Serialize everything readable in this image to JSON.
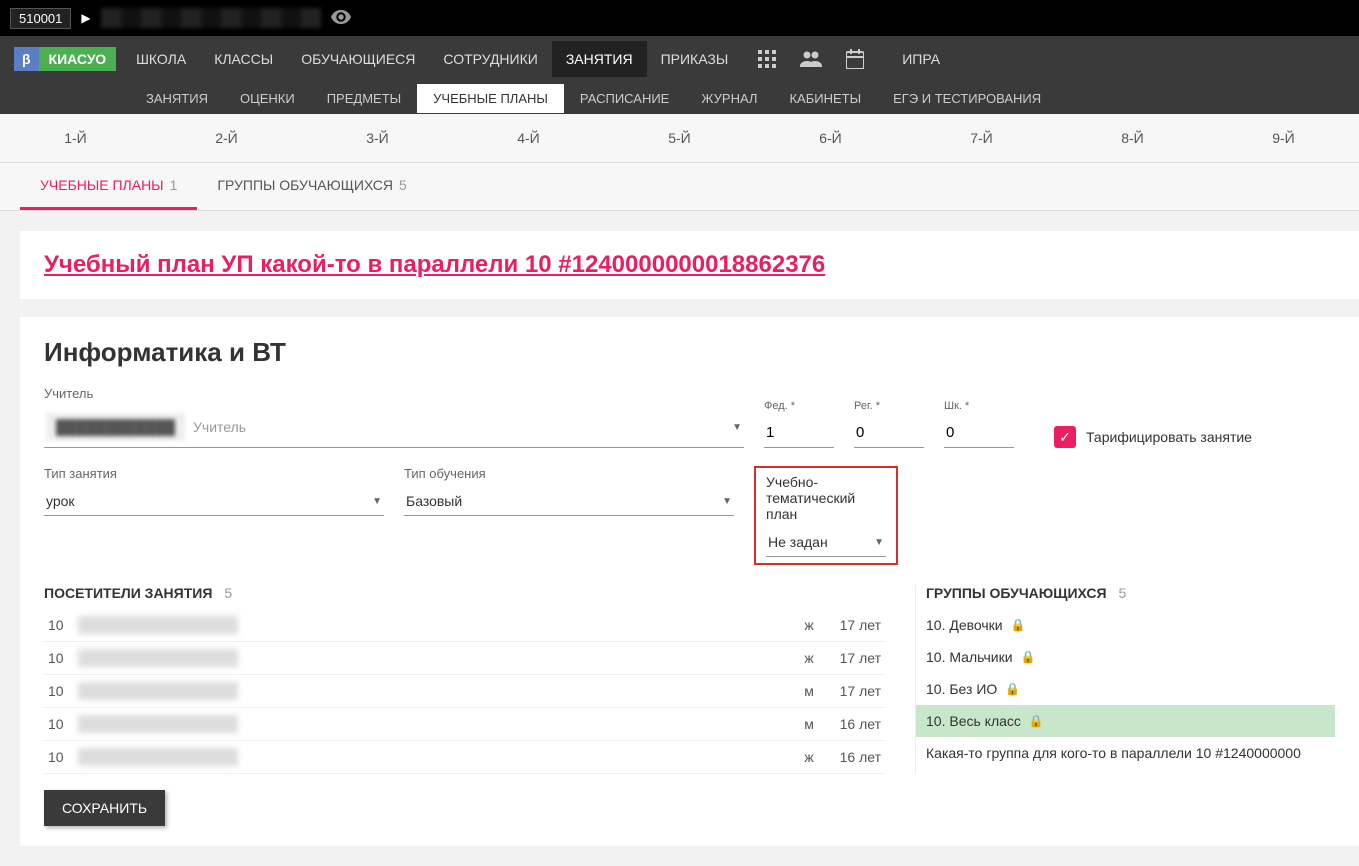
{
  "topbar": {
    "id": "510001"
  },
  "logo": {
    "beta": "β",
    "name": "КИАСУО"
  },
  "mainnav": [
    "ШКОЛА",
    "КЛАССЫ",
    "ОБУЧАЮЩИЕСЯ",
    "СОТРУДНИКИ",
    "ЗАНЯТИЯ",
    "ПРИКАЗЫ"
  ],
  "mainnav_active": 4,
  "mainnav_right": "ИПРА",
  "subnav": [
    "ЗАНЯТИЯ",
    "ОЦЕНКИ",
    "ПРЕДМЕТЫ",
    "УЧЕБНЫЕ ПЛАНЫ",
    "РАСПИСАНИЕ",
    "ЖУРНАЛ",
    "КАБИНЕТЫ",
    "ЕГЭ И ТЕСТИРОВАНИЯ"
  ],
  "subnav_active": 3,
  "grades": [
    "1-Й",
    "2-Й",
    "3-Й",
    "4-Й",
    "5-Й",
    "6-Й",
    "7-Й",
    "8-Й",
    "9-Й"
  ],
  "tabs": [
    {
      "label": "УЧЕБНЫЕ ПЛАНЫ",
      "count": "1"
    },
    {
      "label": "ГРУППЫ ОБУЧАЮЩИХСЯ",
      "count": "5"
    }
  ],
  "tabs_active": 0,
  "plan_link": "Учебный план УП какой-то в параллели 10 #1240000000018862376",
  "subject_title": "Информатика и ВТ",
  "form": {
    "teacher_label": "Учитель",
    "teacher_placeholder": "Учитель",
    "fed_label": "Фед. *",
    "fed_value": "1",
    "reg_label": "Рег. *",
    "reg_value": "0",
    "shk_label": "Шк. *",
    "shk_value": "0",
    "tariff_label": "Тарифицировать занятие",
    "type_label": "Тип занятия",
    "type_value": "урок",
    "edu_label": "Тип обучения",
    "edu_value": "Базовый",
    "theme_label": "Учебно-тематический план",
    "theme_value": "Не задан"
  },
  "visitors": {
    "title": "ПОСЕТИТЕЛИ ЗАНЯТИЯ",
    "count": "5",
    "rows": [
      {
        "grade": "10",
        "gender": "ж",
        "age": "17 лет"
      },
      {
        "grade": "10",
        "gender": "ж",
        "age": "17 лет"
      },
      {
        "grade": "10",
        "gender": "м",
        "age": "17 лет"
      },
      {
        "grade": "10",
        "gender": "м",
        "age": "16 лет"
      },
      {
        "grade": "10",
        "gender": "ж",
        "age": "16 лет"
      }
    ]
  },
  "groups": {
    "title": "ГРУППЫ ОБУЧАЮЩИХСЯ",
    "count": "5",
    "rows": [
      {
        "label": "10. Девочки",
        "hl": false
      },
      {
        "label": "10. Мальчики",
        "hl": false
      },
      {
        "label": "10. Без ИО",
        "hl": false
      },
      {
        "label": "10. Весь класс",
        "hl": true
      },
      {
        "label": "Какая-то группа для кого-то в параллели 10 #1240000000",
        "hl": false,
        "nolock": true
      }
    ]
  },
  "save": "СОХРАНИТЬ"
}
